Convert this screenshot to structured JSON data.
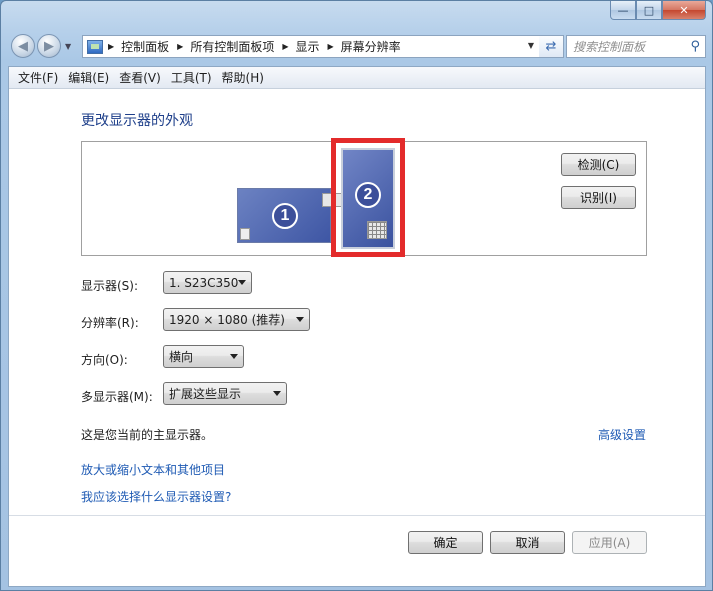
{
  "window": {
    "caption_buttons": {
      "minimize": "—",
      "maximize": "□",
      "close": "✕"
    }
  },
  "nav": {
    "breadcrumbs": [
      "控制面板",
      "所有控制面板项",
      "显示",
      "屏幕分辨率"
    ],
    "search_placeholder": "搜索控制面板",
    "icons": {
      "back": "arrow-left",
      "forward": "arrow-right",
      "refresh": "refresh",
      "search": "magnifier"
    }
  },
  "menu": [
    "文件(F)",
    "编辑(E)",
    "查看(V)",
    "工具(T)",
    "帮助(H)"
  ],
  "main": {
    "heading": "更改显示器的外观",
    "monitors": [
      {
        "number": "1",
        "selected": false
      },
      {
        "number": "2",
        "selected": true
      }
    ],
    "detect_button": "检测(C)",
    "identify_button": "识别(I)",
    "fields": {
      "display_label": "显示器(S):",
      "display_value": "1. S23C350",
      "resolution_label": "分辨率(R):",
      "resolution_value": "1920 × 1080 (推荐)",
      "orientation_label": "方向(O):",
      "orientation_value": "横向",
      "multi_label": "多显示器(M):",
      "multi_value": "扩展这些显示"
    },
    "primary_info": "这是您当前的主显示器。",
    "advanced_link": "高级设置",
    "links": [
      "放大或缩小文本和其他项目",
      "我应该选择什么显示器设置?"
    ]
  },
  "buttons": {
    "ok": "确定",
    "cancel": "取消",
    "apply": "应用(A)"
  },
  "colors": {
    "selection_border": "#e32b2b",
    "link": "#1f5bb4",
    "heading": "#1e3f8a"
  }
}
